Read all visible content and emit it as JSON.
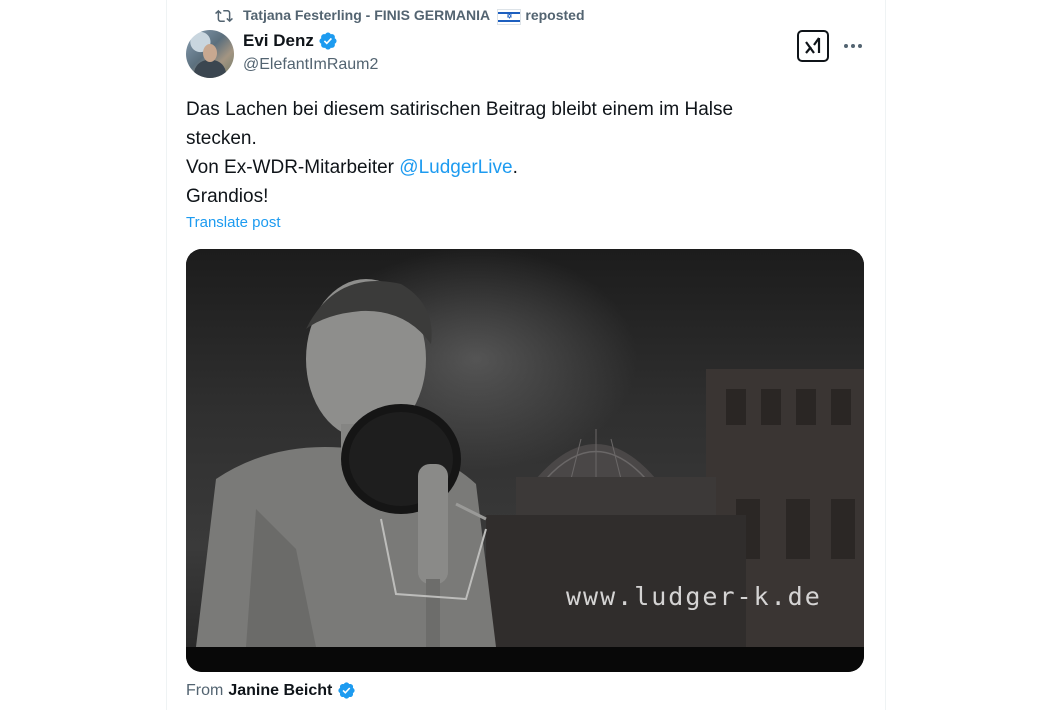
{
  "repost": {
    "reposter_name": "Tatjana Festerling - FINIS GERMANIA",
    "reposted_label": "reposted",
    "flag_icon": "israel-flag-icon"
  },
  "author": {
    "display_name": "Evi Denz",
    "handle": "@ElefantImRaum2",
    "verified_icon": "verified-badge-icon",
    "verified_color": "#1d9bf0"
  },
  "post": {
    "line1": "Das Lachen bei diesem satirischen Beitrag bleibt einem im Halse",
    "line2": "stecken.",
    "line3_prefix": "Von Ex-WDR-Mitarbeiter ",
    "mention": "@LudgerLive",
    "line3_suffix": ".",
    "line4": "Grandios!",
    "translate_label": "Translate post"
  },
  "media": {
    "watermark": "www.ludger-k.de"
  },
  "source": {
    "from_label": "From",
    "source_name": "Janine Beicht"
  },
  "colors": {
    "accent": "#1d9bf0",
    "text_primary": "#0f1419",
    "text_secondary": "#536471"
  }
}
